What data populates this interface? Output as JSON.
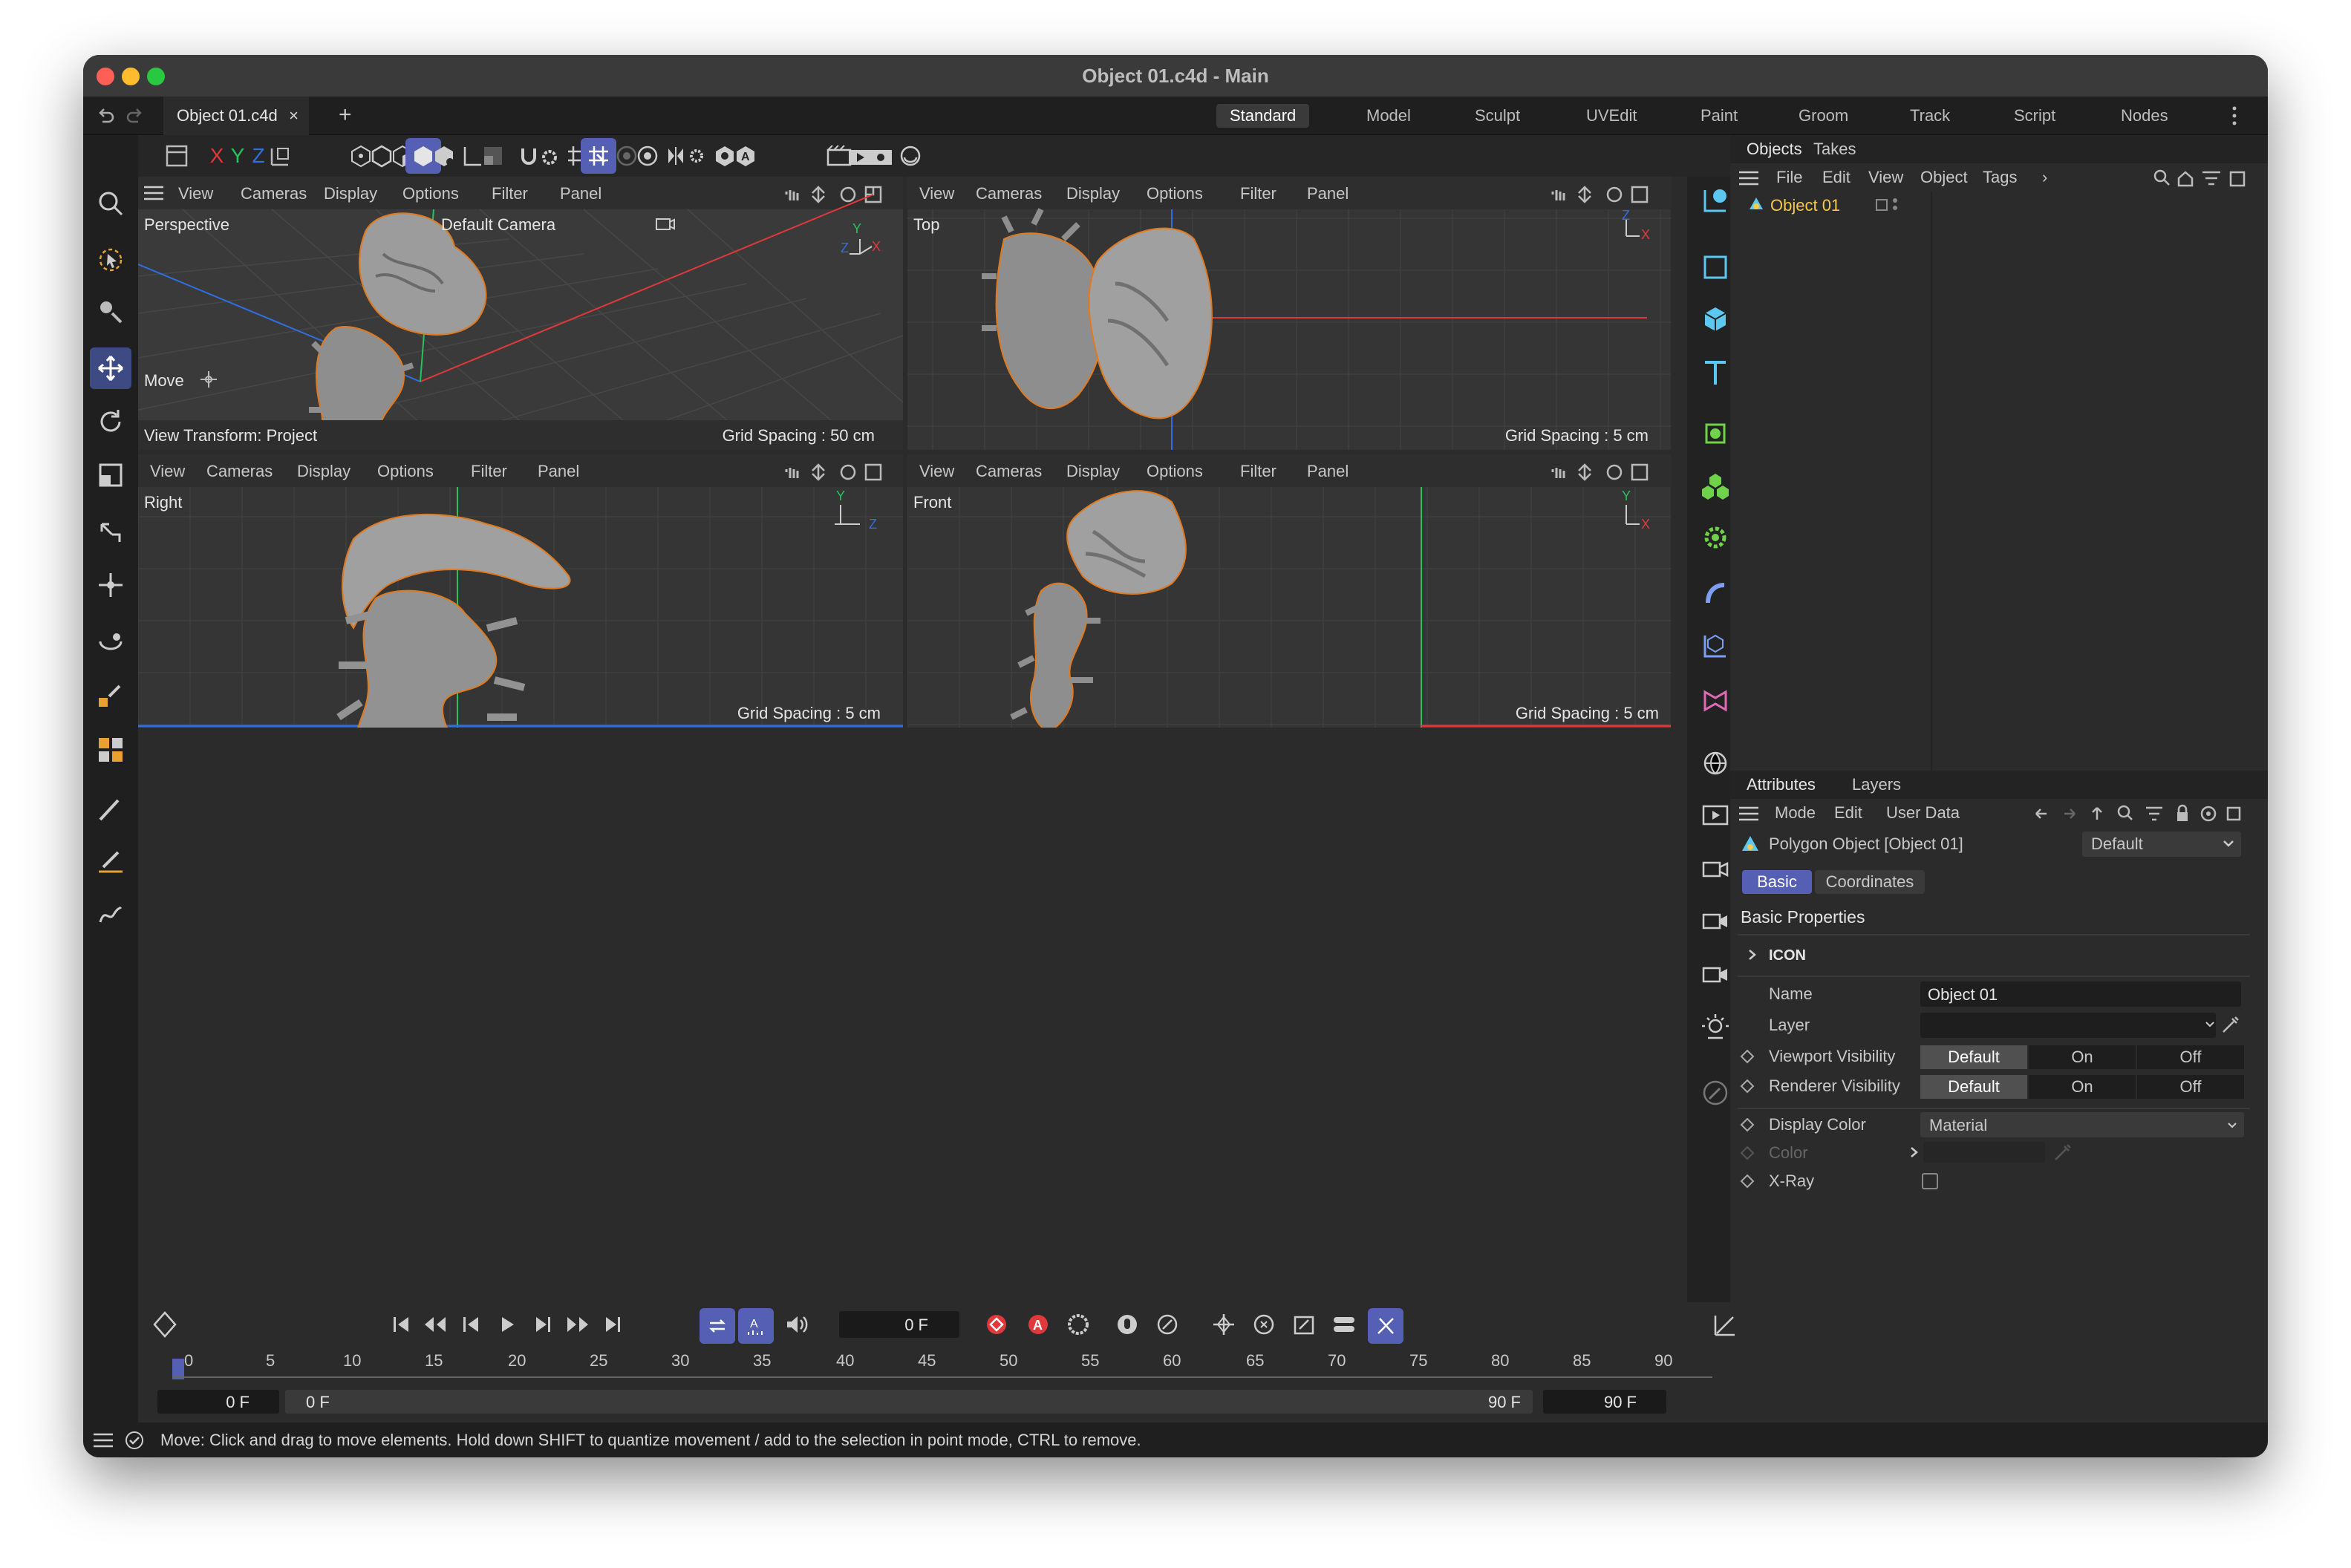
{
  "window": {
    "title": "Object 01.c4d - Main"
  },
  "tabs": {
    "doc_tab": "Object 01.c4d",
    "close": "×",
    "add": "+"
  },
  "layouts": [
    "Standard",
    "Model",
    "Sculpt",
    "UVEdit",
    "Paint",
    "Groom",
    "Track",
    "Script",
    "Nodes"
  ],
  "axis_buttons": [
    "X",
    "Y",
    "Z"
  ],
  "viewport_menu": [
    "View",
    "Cameras",
    "Display",
    "Options",
    "Filter",
    "Panel"
  ],
  "viewports": {
    "perspective": {
      "name": "Perspective",
      "camera": "Default Camera",
      "tool": "Move",
      "footer_left": "View Transform: Project",
      "grid": "Grid Spacing : 50 cm"
    },
    "top": {
      "name": "Top",
      "grid": "Grid Spacing : 5 cm"
    },
    "right": {
      "name": "Right",
      "grid": "Grid Spacing : 5 cm"
    },
    "front": {
      "name": "Front",
      "grid": "Grid Spacing : 5 cm"
    }
  },
  "objects_panel": {
    "tabs": [
      "Objects",
      "Takes"
    ],
    "menu": [
      "File",
      "Edit",
      "View",
      "Object",
      "Tags"
    ],
    "more": "›",
    "items": [
      {
        "name": "Object 01"
      }
    ]
  },
  "attributes_panel": {
    "tabs": [
      "Attributes",
      "Layers"
    ],
    "menu": [
      "Mode",
      "Edit",
      "User Data"
    ],
    "object_label": "Polygon Object [Object 01]",
    "preset": "Default",
    "subtabs": [
      "Basic",
      "Coordinates"
    ],
    "section": "Basic Properties",
    "group": "ICON",
    "rows": {
      "name_label": "Name",
      "name_value": "Object 01",
      "layer_label": "Layer",
      "viewport_vis_label": "Viewport Visibility",
      "renderer_vis_label": "Renderer Visibility",
      "vis_options": [
        "Default",
        "On",
        "Off"
      ],
      "display_color_label": "Display Color",
      "display_color_value": "Material",
      "color_label": "Color",
      "xray_label": "X-Ray"
    }
  },
  "timeline": {
    "current_frame": "0 F",
    "ruler": [
      "0",
      "5",
      "10",
      "15",
      "20",
      "25",
      "30",
      "35",
      "40",
      "45",
      "50",
      "55",
      "60",
      "65",
      "70",
      "75",
      "80",
      "85",
      "90"
    ],
    "start_field": "0 F",
    "range_start": "0 F",
    "range_end": "90 F",
    "end_field": "90 F"
  },
  "status": {
    "message": "Move: Click and drag to move elements. Hold down SHIFT to quantize movement / add to the selection in point mode, CTRL to remove."
  },
  "colors": {
    "accent": "#5560b5",
    "selected_object": "#f5c94a",
    "outline": "#e07a1f",
    "axis_x": "#e0383b",
    "axis_y": "#27c25a",
    "axis_z": "#2f6fe0"
  }
}
